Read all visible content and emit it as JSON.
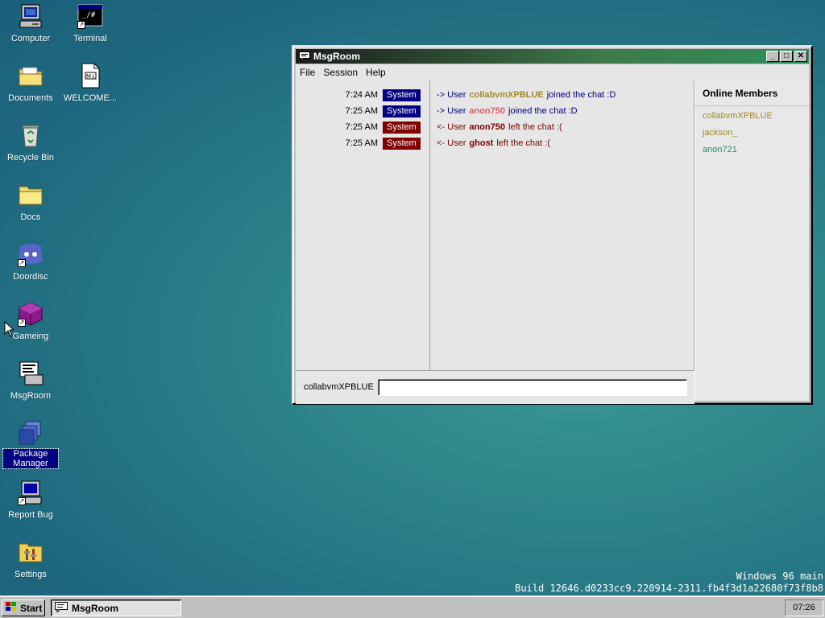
{
  "desktop": {
    "icons": [
      {
        "label": "Computer"
      },
      {
        "label": "Terminal"
      },
      {
        "label": "Documents"
      },
      {
        "label": "WELCOME..."
      },
      {
        "label": "Recycle Bin"
      },
      {
        "label": "Docs"
      },
      {
        "label": "Doordisc"
      },
      {
        "label": "Gameing"
      },
      {
        "label": "MsgRoom"
      },
      {
        "label": "Package Manager"
      },
      {
        "label": "Report Bug"
      },
      {
        "label": "Settings"
      }
    ],
    "build_line1": "Windows 96 main",
    "build_line2": "Build 12646.d0233cc9.220914-2311.fb4f3d1a22680f73f8b8"
  },
  "window": {
    "title": "MsgRoom",
    "menu": [
      "File",
      "Session",
      "Help"
    ],
    "messages": [
      {
        "time": "7:24 AM",
        "sender": "System",
        "badge_color": "#000080",
        "prefix": "-> User",
        "user": "collabvmXPBLUE",
        "user_color": "#a08a2a",
        "text": "joined the chat :D",
        "text_color": "#00007a"
      },
      {
        "time": "7:25 AM",
        "sender": "System",
        "badge_color": "#000080",
        "prefix": "-> User",
        "user": "anon750",
        "user_color": "#e05a6a",
        "text": "joined the chat :D",
        "text_color": "#00007a"
      },
      {
        "time": "7:25 AM",
        "sender": "System",
        "badge_color": "#800000",
        "prefix": "<- User",
        "user": "anon750",
        "user_color": "#7a0000",
        "text": "left the chat :(",
        "text_color": "#7a0000"
      },
      {
        "time": "7:25 AM",
        "sender": "System",
        "badge_color": "#800000",
        "prefix": "<- User",
        "user": "ghost",
        "user_color": "#7a0000",
        "text": "left the chat :(",
        "text_color": "#7a0000"
      }
    ],
    "members_title": "Online Members",
    "members": [
      {
        "name": "collabvmXPBLUE",
        "color": "#a08a2a"
      },
      {
        "name": "jackson_",
        "color": "#a08a2a"
      },
      {
        "name": "anon721",
        "color": "#2a8a5a"
      }
    ],
    "input": {
      "username": "collabvmXPBLUE",
      "value": ""
    }
  },
  "taskbar": {
    "start_label": "Start",
    "task_label": "MsgRoom",
    "clock": "07:26"
  }
}
